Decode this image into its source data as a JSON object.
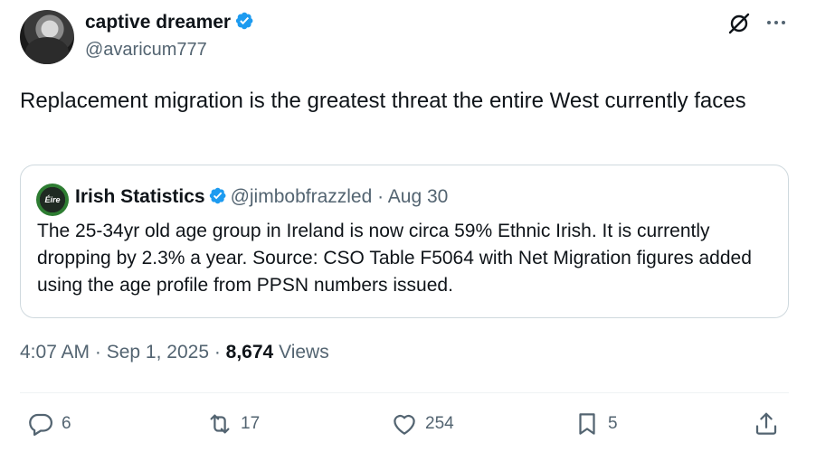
{
  "author": {
    "display_name": "captive dreamer",
    "handle": "@avaricum777"
  },
  "tweet": {
    "text": "Replacement migration is the greatest threat the entire West currently faces"
  },
  "quote": {
    "avatar_text": "Éire",
    "display_name": "Irish Statistics",
    "handle": "@jimbobfrazzled",
    "separator": " · ",
    "date": "Aug 30",
    "text": "The 25-34yr old age group in Ireland is now circa 59% Ethnic Irish. It is currently dropping by 2.3% a year. Source: CSO Table F5064 with Net Migration figures added using the age profile from PPSN numbers issued."
  },
  "meta": {
    "time": "4:07 AM",
    "separator": " · ",
    "date": "Sep 1, 2025",
    "views_count": "8,674",
    "views_label": "Views"
  },
  "actions": {
    "replies": "6",
    "reposts": "17",
    "likes": "254",
    "bookmarks": "5"
  },
  "colors": {
    "verified": "#1d9bf0",
    "text_primary": "#0f1419",
    "text_secondary": "#536471",
    "border": "#cfd9de"
  },
  "icons": [
    "verified-badge-icon",
    "grok-icon",
    "more-icon",
    "reply-icon",
    "retweet-icon",
    "like-icon",
    "bookmark-icon",
    "share-icon"
  ]
}
